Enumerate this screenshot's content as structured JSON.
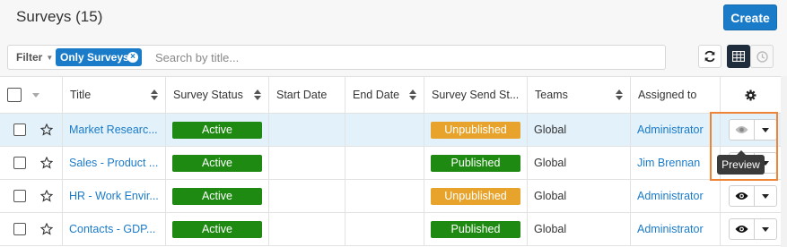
{
  "header": {
    "title": "Surveys (15)",
    "create_label": "Create"
  },
  "toolbar": {
    "filter_label": "Filter",
    "active_filter": "Only Surveys",
    "search_placeholder": "Search by title..."
  },
  "table": {
    "columns": [
      "Title",
      "Survey Status",
      "Start Date",
      "End Date",
      "Survey Send St...",
      "Teams",
      "Assigned to"
    ],
    "rows": [
      {
        "title": "Market Researc...",
        "status": "Active",
        "start": "",
        "end": "",
        "send_status": "Unpublished",
        "team": "Global",
        "assigned": "Administrator"
      },
      {
        "title": "Sales - Product ...",
        "status": "Active",
        "start": "",
        "end": "",
        "send_status": "Published",
        "team": "Global",
        "assigned": "Jim Brennan"
      },
      {
        "title": "HR - Work Envir...",
        "status": "Active",
        "start": "",
        "end": "",
        "send_status": "Unpublished",
        "team": "Global",
        "assigned": "Administrator"
      },
      {
        "title": "Contacts - GDP...",
        "status": "Active",
        "start": "",
        "end": "",
        "send_status": "Published",
        "team": "Global",
        "assigned": "Administrator"
      }
    ]
  },
  "tooltip": {
    "text": "Preview"
  },
  "colors": {
    "accent": "#1a7bc9",
    "active": "#1e8a12",
    "unpublished": "#e7a32b",
    "highlight": "#ef8336"
  },
  "icons": [
    "refresh-icon",
    "grid-view-icon",
    "clock-icon",
    "gear-icon",
    "eye-icon",
    "star-icon",
    "chevron-down-icon"
  ]
}
